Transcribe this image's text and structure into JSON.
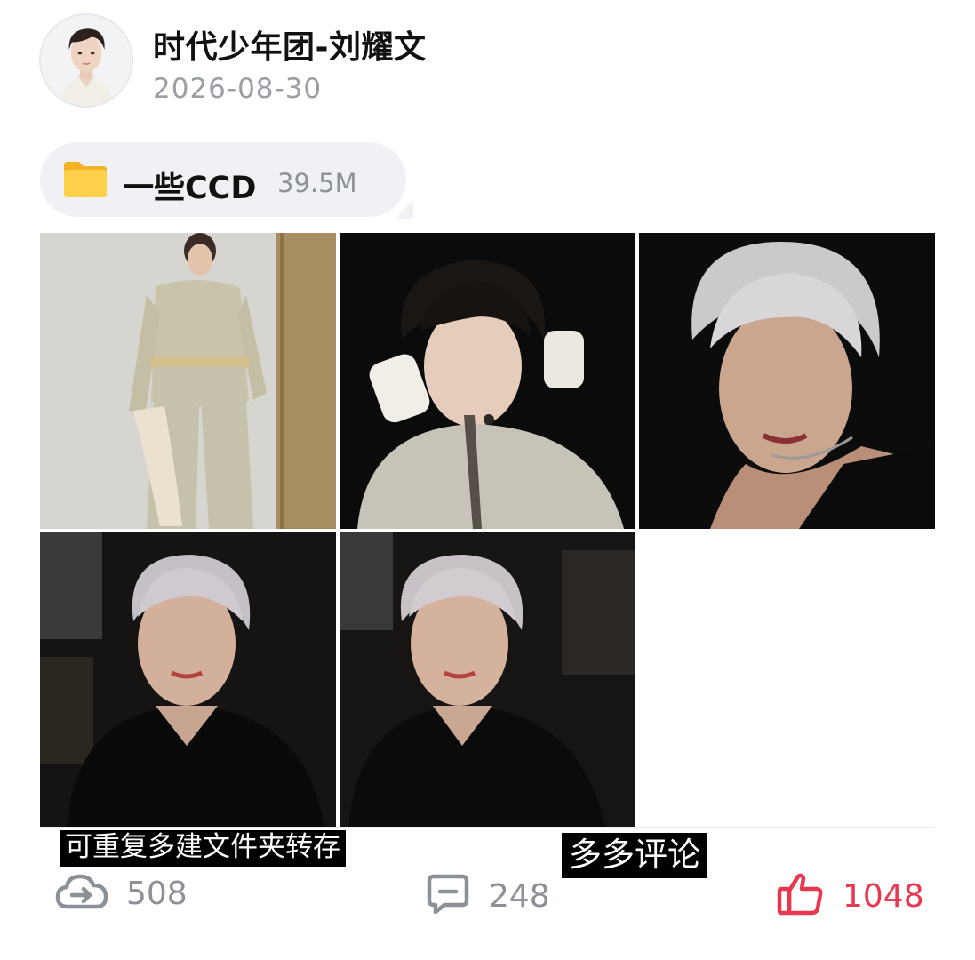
{
  "post": {
    "author_name": "时代少年团-刘耀文",
    "date": "2026-08-30"
  },
  "file": {
    "icon": "folder-icon",
    "name": "一些CCD",
    "size": "39.5M"
  },
  "photos": [
    {
      "name": "photo-1",
      "description_icon": "photo"
    },
    {
      "name": "photo-2",
      "description_icon": "photo"
    },
    {
      "name": "photo-3",
      "description_icon": "photo"
    },
    {
      "name": "photo-4",
      "description_icon": "photo"
    },
    {
      "name": "photo-5",
      "description_icon": "photo"
    }
  ],
  "captions": {
    "save_tip": "可重复多建文件夹转存",
    "comment_tip": "多多评论"
  },
  "actions": {
    "save_count": "508",
    "comment_count": "248",
    "like_count": "1048"
  },
  "colors": {
    "like": "#e8384f",
    "folder": "#f8c437",
    "muted": "#8c9097"
  }
}
